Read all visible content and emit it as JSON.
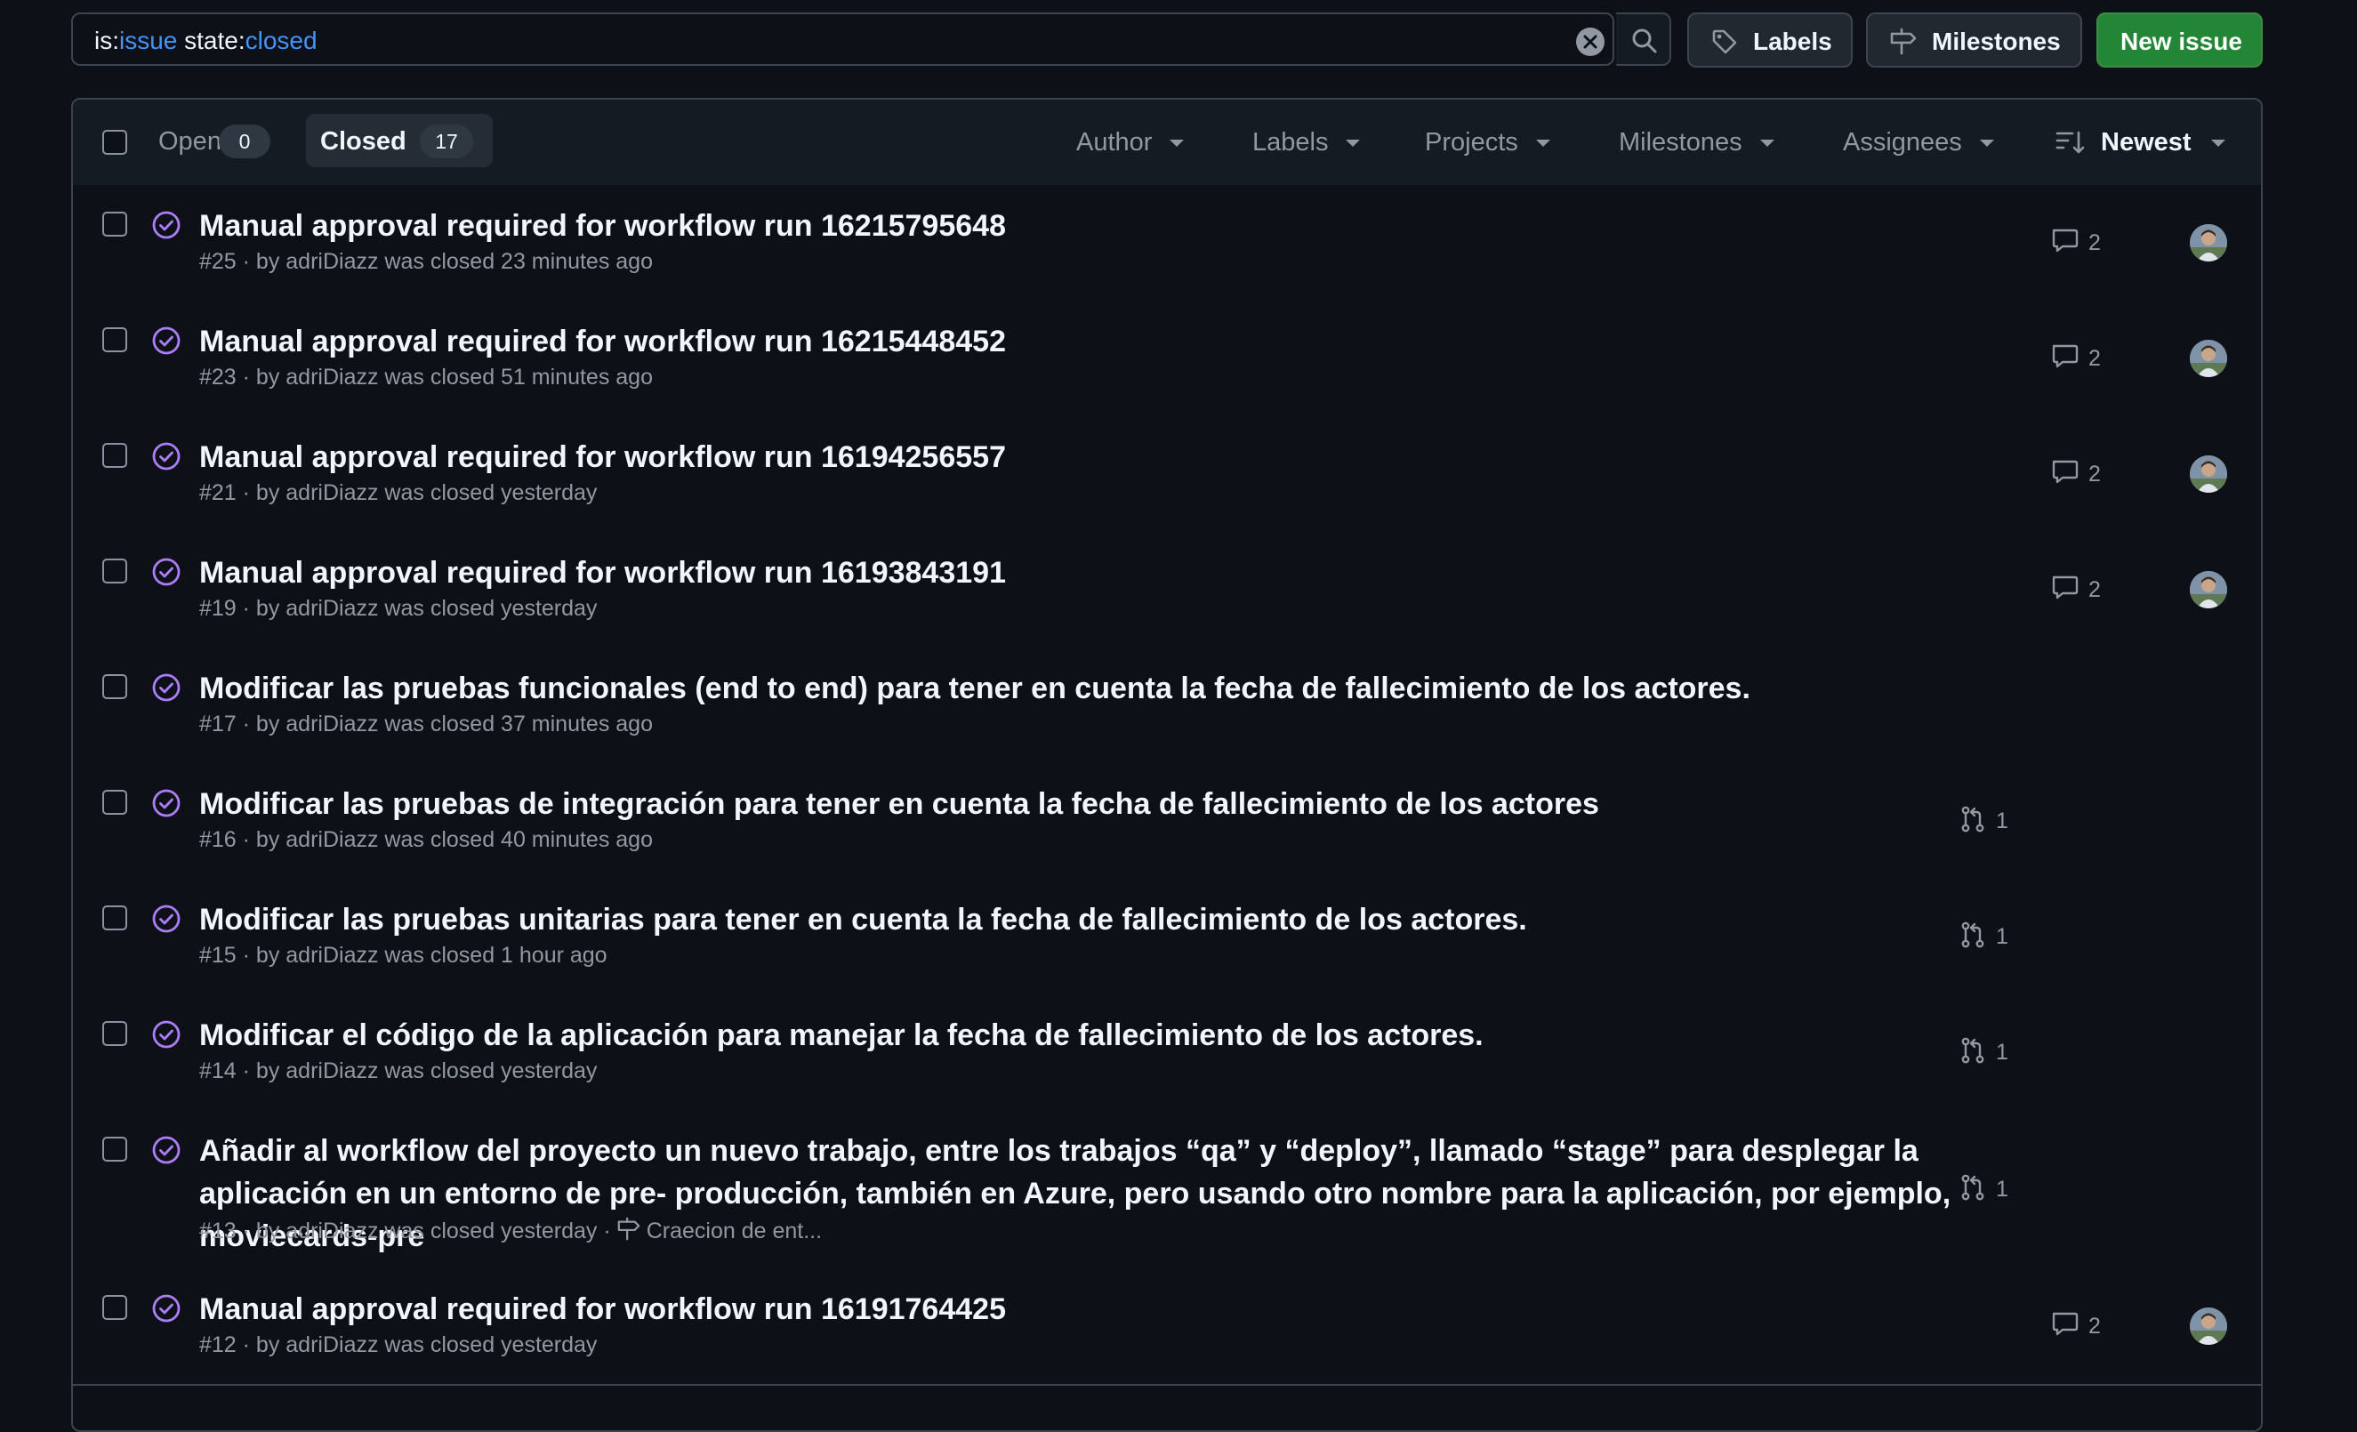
{
  "search": {
    "query_prefix_1": "is:",
    "query_value_1": "issue",
    "query_prefix_2": " state:",
    "query_value_2": "closed"
  },
  "toolbar": {
    "labels": "Labels",
    "milestones": "Milestones",
    "new_issue": "New issue"
  },
  "tabs": {
    "open_label": "Open",
    "open_count": "0",
    "closed_label": "Closed",
    "closed_count": "17"
  },
  "filters": [
    "Author",
    "Labels",
    "Projects",
    "Milestones",
    "Assignees"
  ],
  "sort_label": "Newest",
  "issues": [
    {
      "title": "Manual approval required for workflow run 16215795648",
      "meta": "#25 · by adriDiazz was closed 23 minutes ago",
      "comments": "2"
    },
    {
      "title": "Manual approval required for workflow run 16215448452",
      "meta": "#23 · by adriDiazz was closed 51 minutes ago",
      "comments": "2"
    },
    {
      "title": "Manual approval required for workflow run 16194256557",
      "meta": "#21 · by adriDiazz was closed yesterday",
      "comments": "2"
    },
    {
      "title": "Manual approval required for workflow run 16193843191",
      "meta": "#19 · by adriDiazz was closed yesterday",
      "comments": "2"
    },
    {
      "title": "Modificar las pruebas funcionales (end to end) para tener en cuenta la fecha de fallecimiento de los actores.",
      "meta": "#17 · by adriDiazz was closed 37 minutes ago"
    },
    {
      "title": "Modificar las pruebas de integración para tener en cuenta la fecha de fallecimiento de los actores",
      "meta": "#16 · by adriDiazz was closed 40 minutes ago",
      "prs": "1"
    },
    {
      "title": "Modificar las pruebas unitarias para tener en cuenta la fecha de fallecimiento de los actores.",
      "meta": "#15 · by adriDiazz was closed 1 hour ago",
      "prs": "1"
    },
    {
      "title": "Modificar el código de la aplicación para manejar la fecha de fallecimiento de los actores.",
      "meta": "#14 · by adriDiazz was closed yesterday",
      "prs": "1"
    },
    {
      "title": "Añadir al workflow del proyecto un nuevo trabajo, entre los trabajos “qa” y “deploy”, llamado “stage” para desplegar la aplicación en un entorno de pre- producción, también en Azure, pero usando otro nombre para la aplicación, por ejemplo, moviecards-pre",
      "meta": "#13 · by adriDiazz was closed yesterday ·",
      "milestone": "Craecion de ent...",
      "prs": "1"
    },
    {
      "title": "Manual approval required for workflow run 16191764425",
      "meta": "#12 · by adriDiazz was closed yesterday",
      "comments": "2"
    }
  ],
  "colors": {
    "background": "#0d1117",
    "border": "#3d444d",
    "closed_icon": "#ab7df8",
    "primary_button": "#238636",
    "link_value": "#4493f8"
  },
  "icons": {
    "clear": "x-circle-fill-icon",
    "search": "search-icon",
    "labels": "tag-icon",
    "milestones": "milestone-icon",
    "sort": "sort-desc-icon",
    "closed_issue": "issue-closed-icon",
    "comments": "comment-icon",
    "pull_request": "git-pull-request-icon"
  }
}
